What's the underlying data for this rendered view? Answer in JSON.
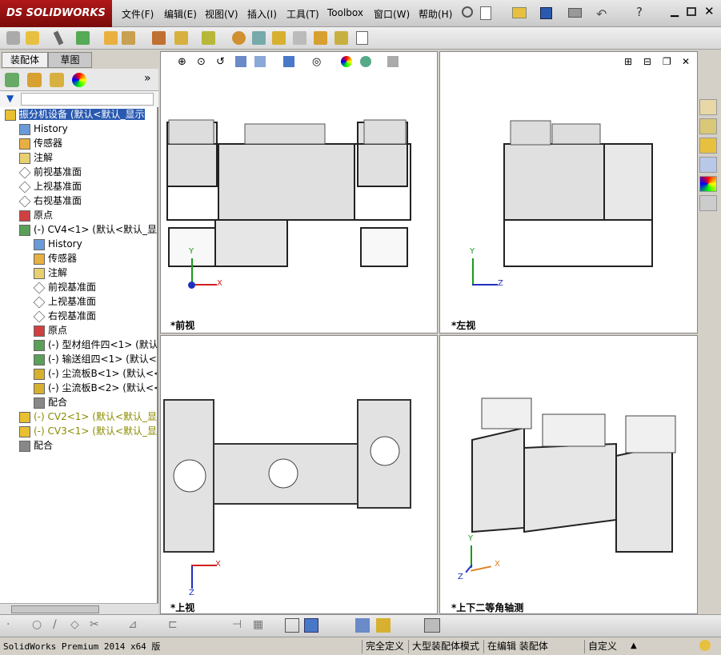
{
  "titlebar": {
    "logo": "DS SOLIDWORKS",
    "menus": [
      "文件(F)",
      "编辑(E)",
      "视图(V)",
      "插入(I)",
      "工具(T)",
      "Toolbox",
      "窗口(W)",
      "帮助(H)"
    ]
  },
  "panel": {
    "tabs": [
      "装配体",
      "草图"
    ],
    "tree": [
      {
        "label": "振分机设备 (默认<默认_显示",
        "level": 0,
        "icon": "warning-assembly-icon"
      },
      {
        "label": "History",
        "level": 1,
        "icon": "history-icon"
      },
      {
        "label": "传感器",
        "level": 1,
        "icon": "sensor-icon"
      },
      {
        "label": "注解",
        "level": 1,
        "icon": "annotation-icon"
      },
      {
        "label": "前视基准面",
        "level": 1,
        "icon": "plane-icon"
      },
      {
        "label": "上视基准面",
        "level": 1,
        "icon": "plane-icon"
      },
      {
        "label": "右视基准面",
        "level": 1,
        "icon": "plane-icon"
      },
      {
        "label": "原点",
        "level": 1,
        "icon": "origin-icon"
      },
      {
        "label": "(-) CV4<1> (默认<默认_显示",
        "level": 1,
        "icon": "subassembly-icon"
      },
      {
        "label": "History",
        "level": 2,
        "icon": "history-icon"
      },
      {
        "label": "传感器",
        "level": 2,
        "icon": "sensor-icon"
      },
      {
        "label": "注解",
        "level": 2,
        "icon": "annotation-icon"
      },
      {
        "label": "前视基准面",
        "level": 2,
        "icon": "plane-icon"
      },
      {
        "label": "上视基准面",
        "level": 2,
        "icon": "plane-icon"
      },
      {
        "label": "右视基准面",
        "level": 2,
        "icon": "plane-icon"
      },
      {
        "label": "原点",
        "level": 2,
        "icon": "origin-icon"
      },
      {
        "label": "(-) 型材组件四<1> (默认<",
        "level": 2,
        "icon": "subassembly-icon"
      },
      {
        "label": "(-) 输送组四<1> (默认<",
        "level": 2,
        "icon": "subassembly-icon"
      },
      {
        "label": "(-) 尘流板B<1> (默认<<",
        "level": 2,
        "icon": "part-icon"
      },
      {
        "label": "(-) 尘流板B<2> (默认<<",
        "level": 2,
        "icon": "part-icon"
      },
      {
        "label": "配合",
        "level": 2,
        "icon": "mate-icon"
      },
      {
        "label": "(-) CV2<1> (默认<默认_显",
        "level": 1,
        "icon": "warning-assembly-icon"
      },
      {
        "label": "(-) CV3<1> (默认<默认_显",
        "level": 1,
        "icon": "warning-assembly-icon"
      },
      {
        "label": "配合",
        "level": 1,
        "icon": "mate-icon"
      }
    ]
  },
  "views": [
    {
      "label": "*前视"
    },
    {
      "label": "*左视"
    },
    {
      "label": "*上视"
    },
    {
      "label": "*上下二等角轴测"
    }
  ],
  "axes": {
    "x": "X",
    "y": "Y",
    "z": "Z"
  },
  "status": {
    "app": "SolidWorks Premium 2014 x64 版",
    "defined": "完全定义",
    "mode": "大型装配体模式",
    "editing": "在编辑 装配体",
    "units": "自定义"
  }
}
